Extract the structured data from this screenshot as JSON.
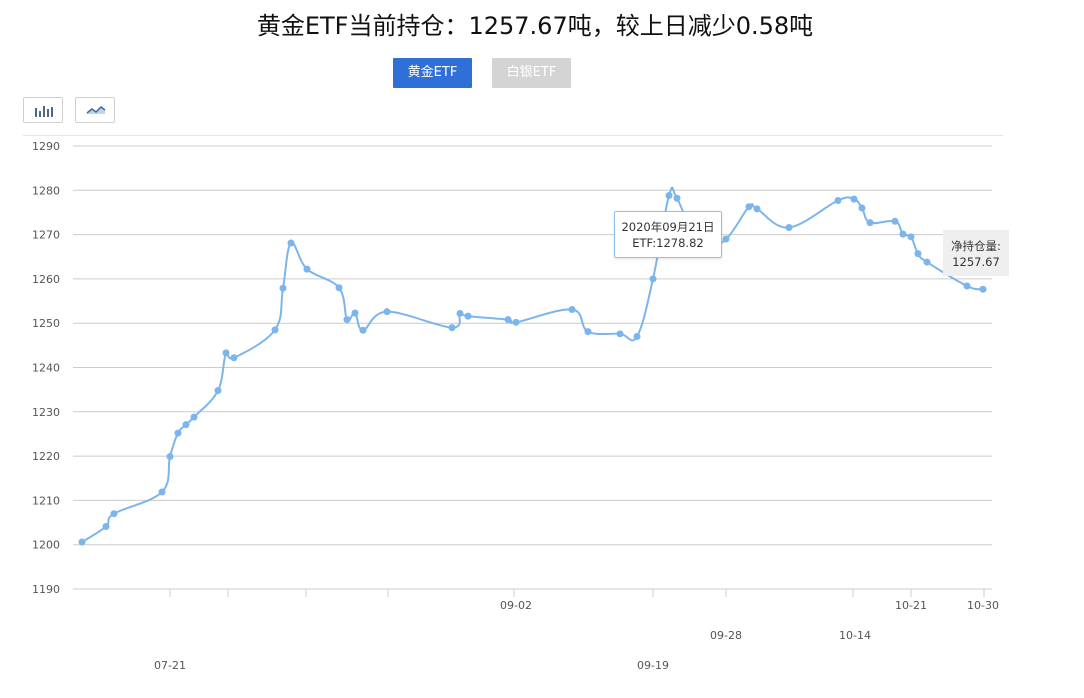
{
  "title": "黄金ETF当前持仓：1257.67吨，较上日减少0.58吨",
  "tabs": [
    {
      "label": "黄金ETF",
      "active": true
    },
    {
      "label": "白银ETF",
      "active": false
    }
  ],
  "view_buttons": [
    {
      "icon": "bar-chart-icon"
    },
    {
      "icon": "line-chart-icon"
    }
  ],
  "tooltip": {
    "date": "2020年09月21日",
    "value": "ETF:1278.82"
  },
  "holding_label": {
    "label": "净持仓量:",
    "value": "1257.67"
  },
  "colors": {
    "series": "#7cb5ec",
    "grid": "#cccccc",
    "tab_active": "#2f6fd8",
    "tab_inactive": "#d4d4d4"
  },
  "chart_data": {
    "type": "line",
    "ylim": [
      1190,
      1290
    ],
    "yticks": [
      1190,
      1200,
      1210,
      1220,
      1230,
      1240,
      1250,
      1260,
      1270,
      1280,
      1290
    ],
    "grid": true,
    "series": [
      {
        "values": [
          1200.6,
          1204.1,
          1207.0,
          1211.9,
          1219.9,
          1225.2,
          1227.1,
          1228.8,
          1234.8,
          1243.3,
          1242.2,
          1248.5,
          1257.9,
          1268.1,
          1262.2,
          1258.0,
          1250.8,
          1252.3,
          1248.4,
          1252.6,
          1249.0,
          1252.2,
          1251.6,
          1250.8,
          1250.2,
          1253.1,
          1248.1,
          1247.6,
          1247.0,
          1260.0,
          1278.82,
          1278.2,
          1267.0,
          1269.0,
          1276.3,
          1275.8,
          1271.6,
          1277.7,
          1278.0,
          1276.0,
          1272.7,
          1273.0,
          1270.1,
          1269.5,
          1265.7,
          1263.8,
          1258.4,
          1257.67
        ]
      }
    ],
    "x_labels": [
      {
        "text": "07-21",
        "row": 2
      },
      {
        "text": "09-02",
        "row": 0
      },
      {
        "text": "09-19",
        "row": 2
      },
      {
        "text": "09-28",
        "row": 1
      },
      {
        "text": "10-14",
        "row": 1
      },
      {
        "text": "10-21",
        "row": 0
      },
      {
        "text": "10-30",
        "row": 0
      }
    ]
  }
}
